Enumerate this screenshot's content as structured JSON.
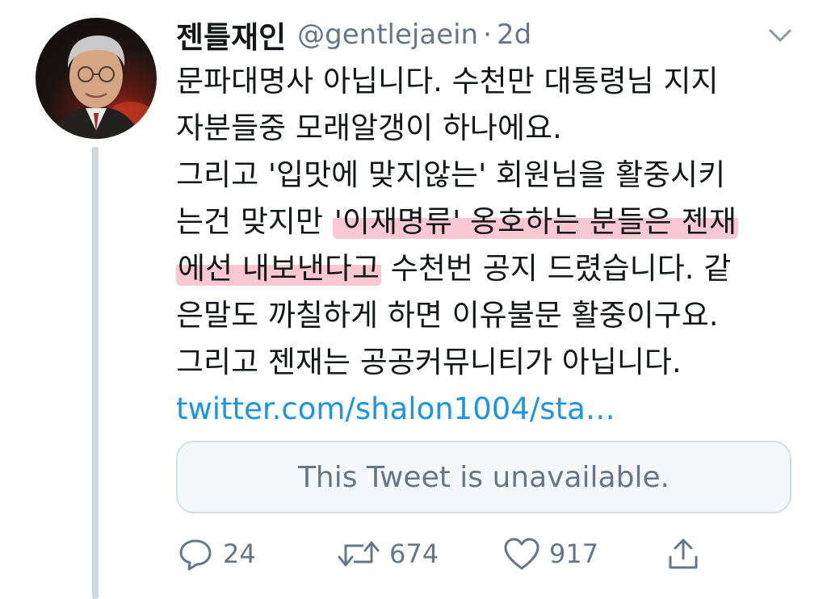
{
  "tweet": {
    "display_name": "젠틀재인",
    "handle": "@gentlejaein",
    "separator": "·",
    "time": "2d",
    "text_lines": [
      {
        "plain": "문파대명사 아닙니다. 수천만 대통령님 지지"
      },
      {
        "plain": "자분들중 모래알갱이 하나에요."
      },
      {
        "plain": "그리고 '입맛에 맞지않는' 회원님을 활중시키"
      },
      {
        "before": "는건 맞지만 ",
        "highlight": "'이재명류' 옹호하는 분들은 젠재",
        "after": ""
      },
      {
        "before": "",
        "highlight": "에선 내보낸다고",
        "after": " 수천번 공지 드렸습니다. 같"
      },
      {
        "plain": "은말도 까칠하게 하면 이유불문 활중이구요."
      },
      {
        "plain": "그리고 젠재는 공공커뮤니티가 아닙니다."
      }
    ],
    "link_text": "twitter.com/shalon1004/sta…",
    "quoted_unavailable": "This Tweet is unavailable.",
    "actions": {
      "reply_count": "24",
      "retweet_count": "674",
      "like_count": "917"
    }
  },
  "icons": {
    "chevron": "chevron-down-icon",
    "reply": "reply-icon",
    "retweet": "retweet-icon",
    "like": "heart-icon",
    "share": "share-icon"
  },
  "colors": {
    "text": "#14171a",
    "secondary": "#657786",
    "link": "#1b95e0",
    "highlight": "#f06e8c",
    "card_bg": "#f5f8fa",
    "thread_line": "#cfd8de"
  }
}
